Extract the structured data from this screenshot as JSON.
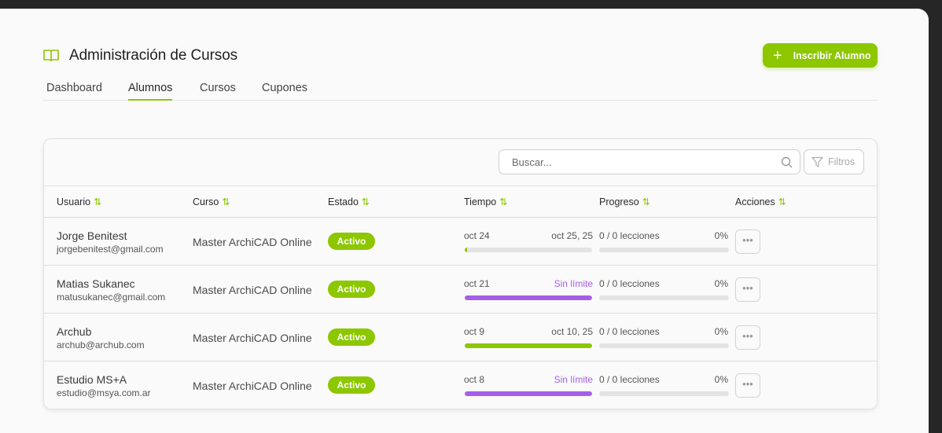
{
  "header": {
    "title": "Administración de Cursos",
    "icon": "book-open-icon",
    "cta_label": "Inscribir Alumno",
    "accent": "#8cc700"
  },
  "tabs": [
    {
      "label": "Dashboard",
      "active": false
    },
    {
      "label": "Alumnos",
      "active": true
    },
    {
      "label": "Cursos",
      "active": false
    },
    {
      "label": "Cupones",
      "active": false
    }
  ],
  "toolbar": {
    "search_placeholder": "Buscar...",
    "filter_label": "Filtros"
  },
  "table": {
    "columns": [
      "Usuario",
      "Curso",
      "Estado",
      "Tiempo",
      "Progreso",
      "Acciones"
    ],
    "rows": [
      {
        "name": "Jorge Benitest",
        "email": "jorgebenitest@gmail.com",
        "course": "Master ArchiCAD Online",
        "status": "Activo",
        "time_start": "oct 24",
        "time_end": "oct 25, 25",
        "unlimited": false,
        "time_fraction": 0.02,
        "progress_text": "0 / 0 lecciones",
        "progress_pct": "0%",
        "progress_fraction": 0
      },
      {
        "name": "Matias Sukanec",
        "email": "matusukanec@gmail.com",
        "course": "Master ArchiCAD Online",
        "status": "Activo",
        "time_start": "oct 21",
        "time_end": "Sin límite",
        "unlimited": true,
        "time_fraction": 1,
        "progress_text": "0 / 0 lecciones",
        "progress_pct": "0%",
        "progress_fraction": 0
      },
      {
        "name": "Archub",
        "email": "archub@archub.com",
        "course": "Master ArchiCAD Online",
        "status": "Activo",
        "time_start": "oct 9",
        "time_end": "oct 10, 25",
        "unlimited": false,
        "time_fraction": 1,
        "progress_text": "0 / 0 lecciones",
        "progress_pct": "0%",
        "progress_fraction": 0
      },
      {
        "name": "Estudio MS+A",
        "email": "estudio@msya.com.ar",
        "course": "Master ArchiCAD Online",
        "status": "Activo",
        "time_start": "oct 8",
        "time_end": "Sin límite",
        "unlimited": true,
        "time_fraction": 1,
        "progress_text": "0 / 0 lecciones",
        "progress_pct": "0%",
        "progress_fraction": 0
      }
    ]
  },
  "colors": {
    "green": "#8cc700",
    "purple": "#a55eea"
  }
}
